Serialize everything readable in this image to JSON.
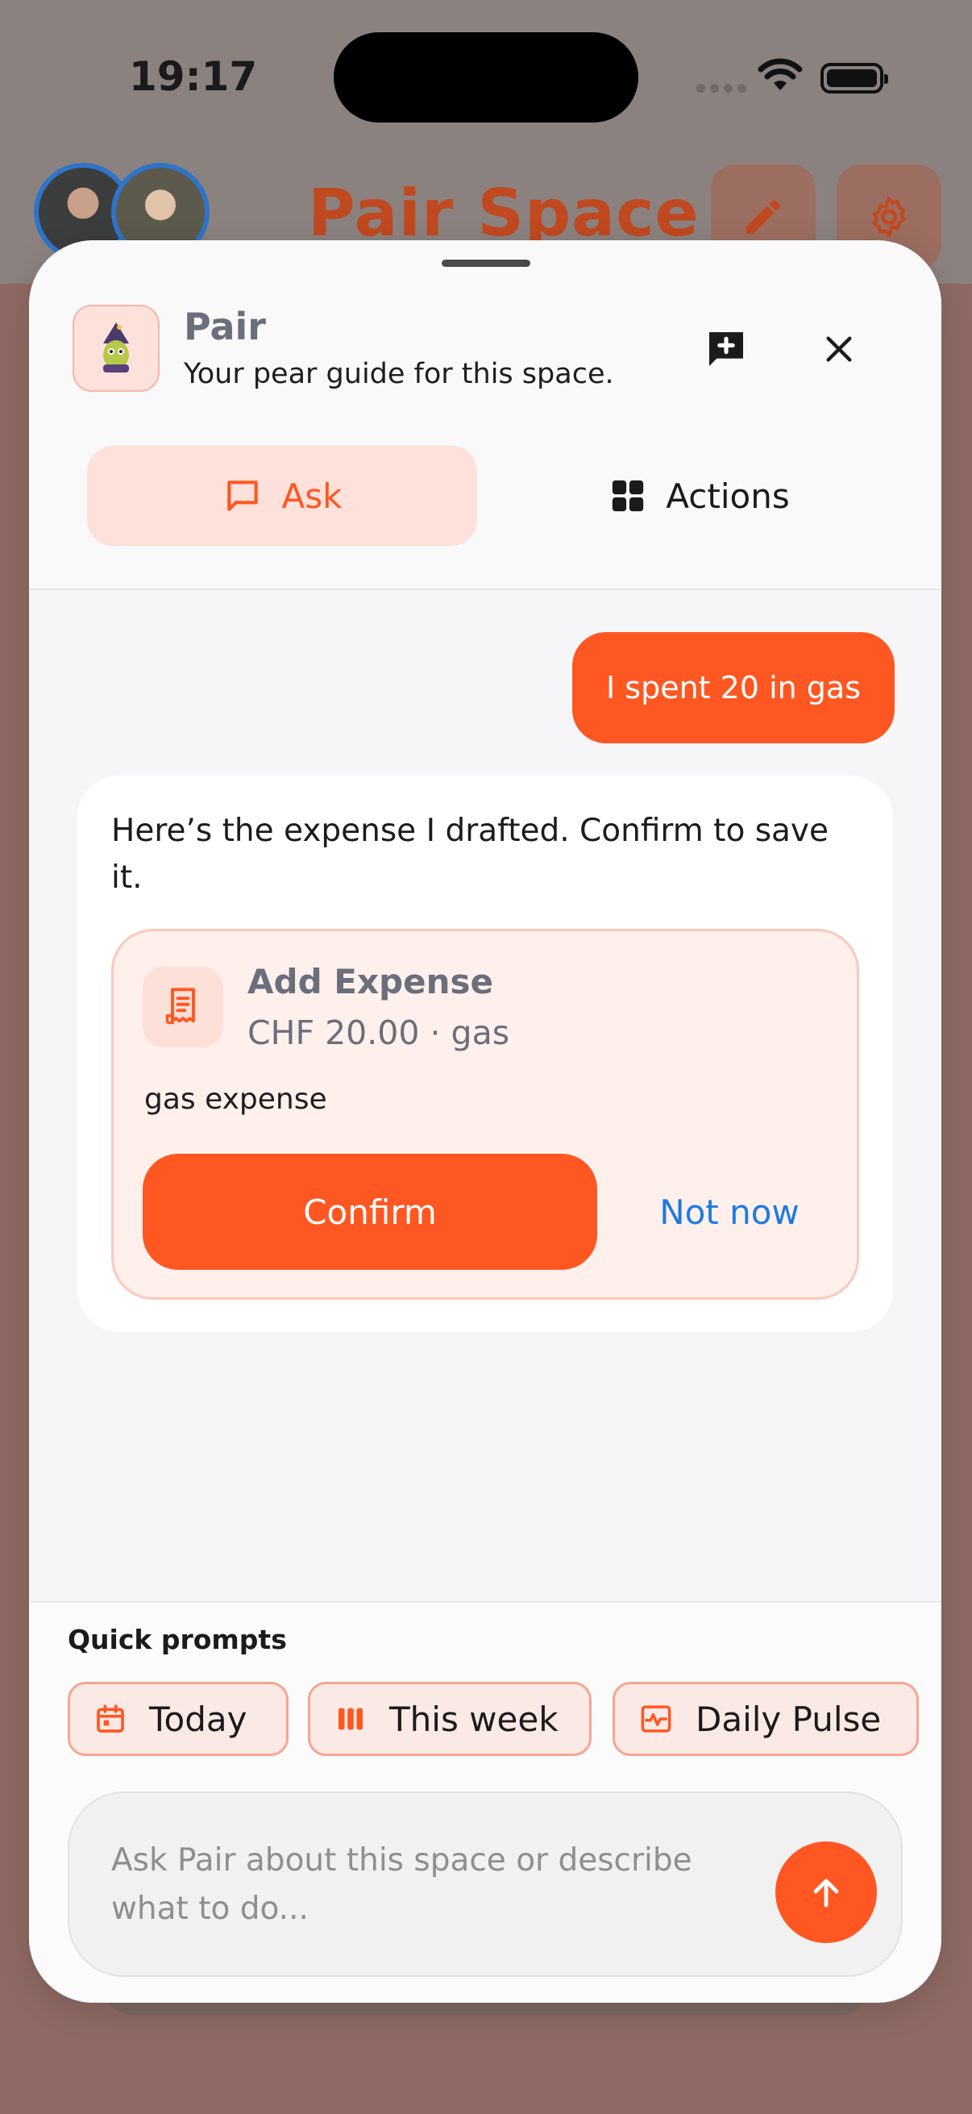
{
  "status_bar": {
    "time": "19:17"
  },
  "app": {
    "title": "Pair Space",
    "edit_icon": "pencil-icon",
    "settings_icon": "gear-icon"
  },
  "sheet": {
    "assistant": {
      "name": "Pair",
      "subtitle": "Your pear guide for this space.",
      "logo": "wizard-pear-avatar"
    },
    "new_chat_icon": "add-comment-icon",
    "close_icon": "close-icon",
    "tabs": [
      {
        "label": "Ask",
        "icon": "chat-bubble-icon",
        "active": true
      },
      {
        "label": "Actions",
        "icon": "grid-icon",
        "active": false
      }
    ],
    "messages": {
      "user": "I spent 20 in gas",
      "assistant": "Here’s the expense I drafted. Confirm to save it."
    },
    "expense_card": {
      "title": "Add Expense",
      "amount_line": "CHF 20.00 · gas",
      "description": "gas expense",
      "icon": "receipt-icon",
      "confirm_label": "Confirm",
      "dismiss_label": "Not now"
    },
    "quick_prompts": {
      "label": "Quick prompts",
      "items": [
        {
          "label": "Today",
          "icon": "calendar-icon"
        },
        {
          "label": "This week",
          "icon": "bars-icon"
        },
        {
          "label": "Daily Pulse",
          "icon": "pulse-icon"
        }
      ]
    },
    "input": {
      "placeholder": "Ask Pair about this space or describe what to do...",
      "send_icon": "arrow-up-icon"
    }
  },
  "colors": {
    "accent": "#ff5722",
    "link": "#1f7ae0",
    "muted_text": "#6b6e7b"
  }
}
